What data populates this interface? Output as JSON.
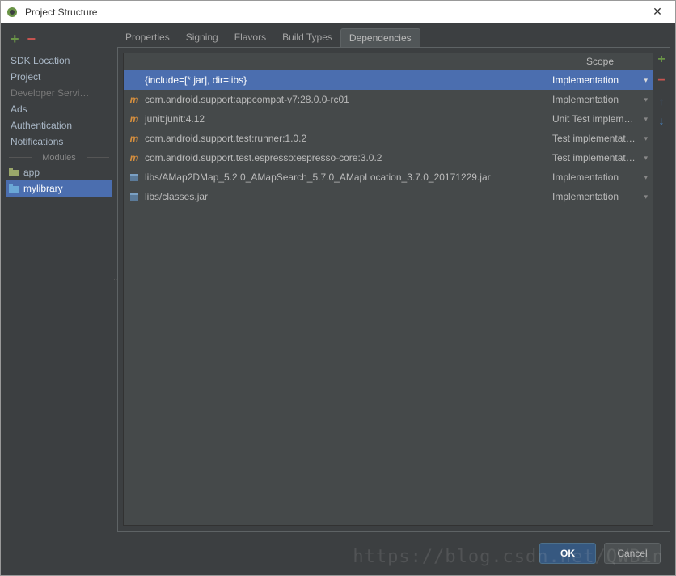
{
  "window": {
    "title": "Project Structure"
  },
  "sidebar": {
    "items": [
      {
        "label": "SDK Location",
        "dim": false
      },
      {
        "label": "Project",
        "dim": false
      },
      {
        "label": "Developer Servi…",
        "dim": true
      },
      {
        "label": "Ads",
        "dim": false
      },
      {
        "label": "Authentication",
        "dim": false
      },
      {
        "label": "Notifications",
        "dim": false
      }
    ],
    "modules_label": "Modules",
    "modules": [
      {
        "label": "app",
        "selected": false
      },
      {
        "label": "mylibrary",
        "selected": true
      }
    ]
  },
  "tabs": {
    "items": [
      "Properties",
      "Signing",
      "Flavors",
      "Build Types",
      "Dependencies"
    ],
    "active": 4
  },
  "table": {
    "scope_header": "Scope",
    "rows": [
      {
        "icon": "",
        "name": "{include=[*.jar], dir=libs}",
        "scope": "Implementation",
        "selected": true
      },
      {
        "icon": "m",
        "name": "com.android.support:appcompat-v7:28.0.0-rc01",
        "scope": "Implementation",
        "selected": false
      },
      {
        "icon": "m",
        "name": "junit:junit:4.12",
        "scope": "Unit Test implem…",
        "selected": false
      },
      {
        "icon": "m",
        "name": "com.android.support.test:runner:1.0.2",
        "scope": "Test implementat…",
        "selected": false
      },
      {
        "icon": "m",
        "name": "com.android.support.test.espresso:espresso-core:3.0.2",
        "scope": "Test implementat…",
        "selected": false
      },
      {
        "icon": "jar",
        "name": "libs/AMap2DMap_5.2.0_AMapSearch_5.7.0_AMapLocation_3.7.0_20171229.jar",
        "scope": "Implementation",
        "selected": false
      },
      {
        "icon": "jar",
        "name": "libs/classes.jar",
        "scope": "Implementation",
        "selected": false
      }
    ]
  },
  "footer": {
    "ok": "OK",
    "cancel": "Cancel"
  },
  "watermark": "https://blog.csdn.net/QWBin"
}
